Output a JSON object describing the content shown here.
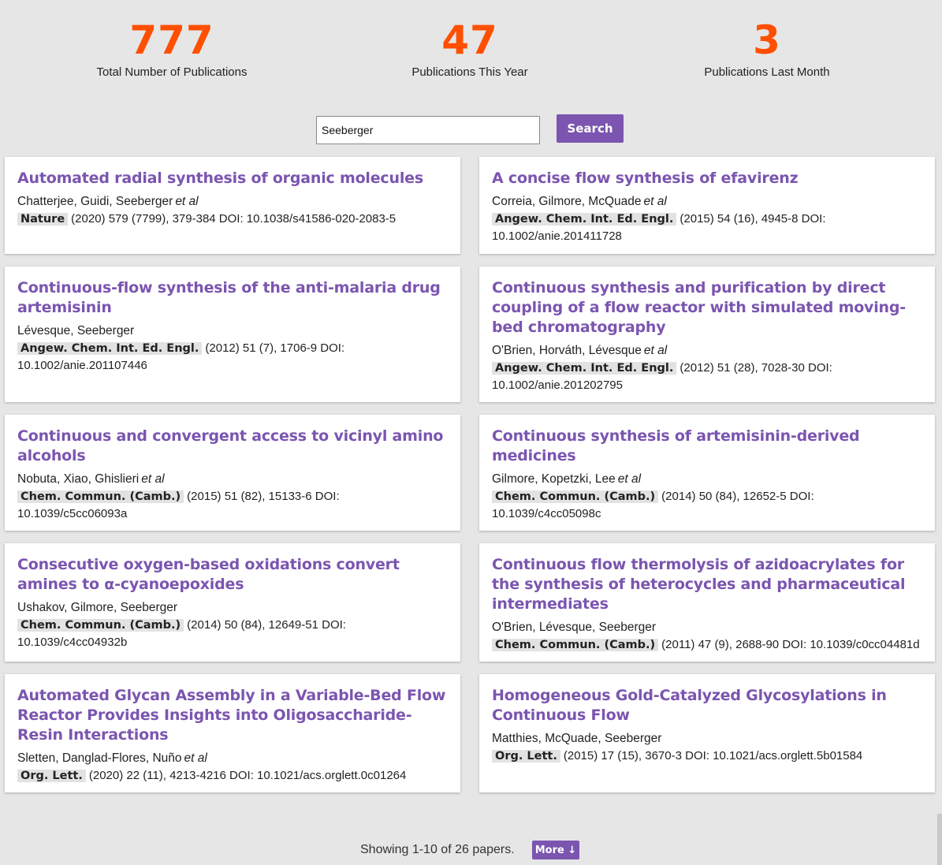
{
  "stats": [
    {
      "value": "777",
      "label": "Total Number of Publications"
    },
    {
      "value": "47",
      "label": "Publications This Year"
    },
    {
      "value": "3",
      "label": "Publications Last Month"
    }
  ],
  "search": {
    "value": "Seeberger",
    "button_label": "Search"
  },
  "publications": [
    {
      "title": "Automated radial synthesis of organic molecules",
      "authors": "Chatterjee, Guidi, Seeberger",
      "et_al": "et al",
      "journal": "Nature",
      "citation": "(2020) 579 (7799), 379-384 DOI: 10.1038/s41586-020-2083-5"
    },
    {
      "title": "A concise flow synthesis of efavirenz",
      "authors": "Correia, Gilmore, McQuade",
      "et_al": "et al",
      "journal": "Angew. Chem. Int. Ed. Engl.",
      "citation": "(2015) 54 (16), 4945-8 DOI: 10.1002/anie.201411728"
    },
    {
      "title": "Continuous-flow synthesis of the anti-malaria drug artemisinin",
      "authors": "Lévesque, Seeberger",
      "et_al": "",
      "journal": "Angew. Chem. Int. Ed. Engl.",
      "citation": "(2012) 51 (7), 1706-9 DOI: 10.1002/anie.201107446"
    },
    {
      "title": "Continuous synthesis and purification by direct coupling of a flow reactor with simulated moving-bed chromatography",
      "authors": "O'Brien, Horváth, Lévesque",
      "et_al": "et al",
      "journal": "Angew. Chem. Int. Ed. Engl.",
      "citation": "(2012) 51 (28), 7028-30 DOI: 10.1002/anie.201202795"
    },
    {
      "title": "Continuous and convergent access to vicinyl amino alcohols",
      "authors": "Nobuta, Xiao, Ghislieri",
      "et_al": "et al",
      "journal": "Chem. Commun. (Camb.)",
      "citation": "(2015) 51 (82), 15133-6 DOI: 10.1039/c5cc06093a"
    },
    {
      "title": "Continuous synthesis of artemisinin-derived medicines",
      "authors": "Gilmore, Kopetzki, Lee",
      "et_al": "et al",
      "journal": "Chem. Commun. (Camb.)",
      "citation": "(2014) 50 (84), 12652-5 DOI: 10.1039/c4cc05098c"
    },
    {
      "title": "Consecutive oxygen-based oxidations convert amines to α-cyanoepoxides",
      "authors": "Ushakov, Gilmore, Seeberger",
      "et_al": "",
      "journal": "Chem. Commun. (Camb.)",
      "citation": "(2014) 50 (84), 12649-51 DOI: 10.1039/c4cc04932b"
    },
    {
      "title": "Continuous flow thermolysis of azidoacrylates for the synthesis of heterocycles and pharmaceutical intermediates",
      "authors": "O'Brien, Lévesque, Seeberger",
      "et_al": "",
      "journal": "Chem. Commun. (Camb.)",
      "citation": "(2011) 47 (9), 2688-90 DOI: 10.1039/c0cc04481d"
    },
    {
      "title": "Automated Glycan Assembly in a Variable-Bed Flow Reactor Provides Insights into Oligosaccharide-Resin Interactions",
      "authors": "Sletten, Danglad-Flores, Nuño",
      "et_al": "et al",
      "journal": "Org. Lett.",
      "citation": "(2020) 22 (11), 4213-4216 DOI: 10.1021/acs.orglett.0c01264"
    },
    {
      "title": "Homogeneous Gold-Catalyzed Glycosylations in Continuous Flow",
      "authors": "Matthies, McQuade, Seeberger",
      "et_al": "",
      "journal": "Org. Lett.",
      "citation": "(2015) 17 (15), 3670-3 DOI: 10.1021/acs.orglett.5b01584"
    }
  ],
  "footer": {
    "showing": "Showing 1-10 of 26 papers.",
    "more_label": "More ↓"
  }
}
